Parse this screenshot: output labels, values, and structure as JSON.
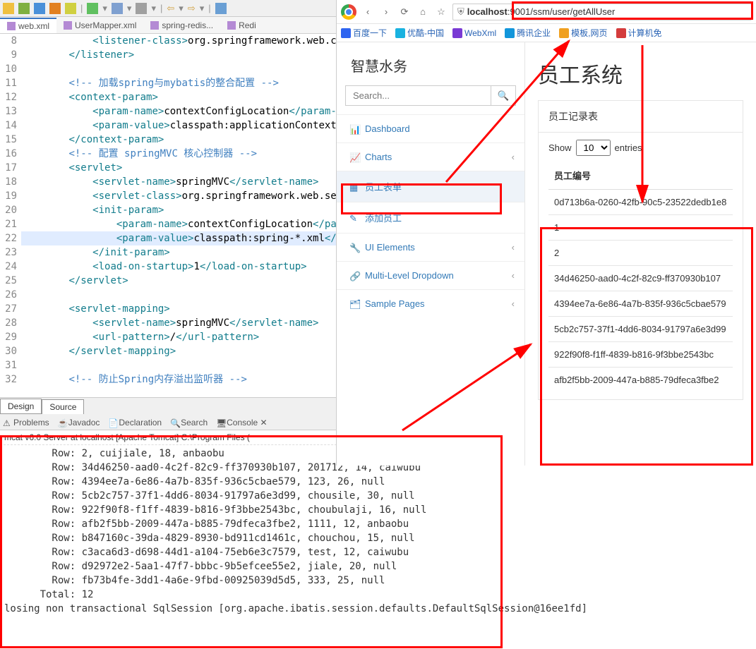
{
  "ide": {
    "tabs": [
      {
        "label": "web.xml",
        "active": true
      },
      {
        "label": "UserMapper.xml",
        "active": false
      },
      {
        "label": "spring-redis...",
        "active": false
      },
      {
        "label": "Redi",
        "active": false
      }
    ],
    "gutter_start": 8,
    "code_lines": [
      {
        "indent": 3,
        "parts": [
          {
            "cls": "c-tag",
            "t": "<listener-class>"
          },
          {
            "cls": "c-txt",
            "t": "org.springframework.web.c"
          }
        ]
      },
      {
        "indent": 2,
        "parts": [
          {
            "cls": "c-tag",
            "t": "</listener>"
          }
        ]
      },
      {
        "indent": 0,
        "parts": [
          {
            "t": ""
          }
        ]
      },
      {
        "indent": 2,
        "parts": [
          {
            "cls": "c-cmt",
            "t": "<!-- 加载spring与mybatis的整合配置 -->"
          }
        ]
      },
      {
        "indent": 2,
        "parts": [
          {
            "cls": "c-tag",
            "t": "<context-param>"
          }
        ]
      },
      {
        "indent": 3,
        "parts": [
          {
            "cls": "c-tag",
            "t": "<param-name>"
          },
          {
            "cls": "c-txt",
            "t": "contextConfigLocation"
          },
          {
            "cls": "c-tag",
            "t": "</param-n"
          }
        ]
      },
      {
        "indent": 3,
        "parts": [
          {
            "cls": "c-tag",
            "t": "<param-value>"
          },
          {
            "cls": "c-txt",
            "t": "classpath:applicationContext"
          }
        ]
      },
      {
        "indent": 2,
        "parts": [
          {
            "cls": "c-tag",
            "t": "</context-param>"
          }
        ]
      },
      {
        "indent": 2,
        "parts": [
          {
            "cls": "c-cmt",
            "t": "<!-- 配置 springMVC 核心控制器 -->"
          }
        ]
      },
      {
        "indent": 2,
        "parts": [
          {
            "cls": "c-tag",
            "t": "<servlet>"
          }
        ]
      },
      {
        "indent": 3,
        "parts": [
          {
            "cls": "c-tag",
            "t": "<servlet-name>"
          },
          {
            "cls": "c-txt",
            "t": "springMVC"
          },
          {
            "cls": "c-tag",
            "t": "</servlet-name>"
          }
        ]
      },
      {
        "indent": 3,
        "parts": [
          {
            "cls": "c-tag",
            "t": "<servlet-class>"
          },
          {
            "cls": "c-txt",
            "t": "org.springframework.web.se"
          }
        ]
      },
      {
        "indent": 3,
        "parts": [
          {
            "cls": "c-tag",
            "t": "<init-param>"
          }
        ]
      },
      {
        "indent": 4,
        "parts": [
          {
            "cls": "c-tag",
            "t": "<param-name>"
          },
          {
            "cls": "c-txt",
            "t": "contextConfigLocation"
          },
          {
            "cls": "c-tag",
            "t": "</pa"
          }
        ]
      },
      {
        "hl": true,
        "indent": 4,
        "parts": [
          {
            "cls": "c-tag",
            "t": "<param-value>"
          },
          {
            "cls": "c-txt",
            "t": "classpath:spring-*.xml"
          },
          {
            "cls": "c-tag",
            "t": "</p"
          }
        ]
      },
      {
        "indent": 3,
        "parts": [
          {
            "cls": "c-tag",
            "t": "</init-param>"
          }
        ]
      },
      {
        "indent": 3,
        "parts": [
          {
            "cls": "c-tag",
            "t": "<load-on-startup>"
          },
          {
            "cls": "c-txt",
            "t": "1"
          },
          {
            "cls": "c-tag",
            "t": "</load-on-startup>"
          }
        ]
      },
      {
        "indent": 2,
        "parts": [
          {
            "cls": "c-tag",
            "t": "</servlet>"
          }
        ]
      },
      {
        "indent": 0,
        "parts": [
          {
            "t": ""
          }
        ]
      },
      {
        "indent": 2,
        "parts": [
          {
            "cls": "c-tag",
            "t": "<servlet-mapping>"
          }
        ]
      },
      {
        "indent": 3,
        "parts": [
          {
            "cls": "c-tag",
            "t": "<servlet-name>"
          },
          {
            "cls": "c-txt",
            "t": "springMVC"
          },
          {
            "cls": "c-tag",
            "t": "</servlet-name>"
          }
        ]
      },
      {
        "indent": 3,
        "parts": [
          {
            "cls": "c-tag",
            "t": "<url-pattern>"
          },
          {
            "cls": "c-txt",
            "t": "/"
          },
          {
            "cls": "c-tag",
            "t": "</url-pattern>"
          }
        ]
      },
      {
        "indent": 2,
        "parts": [
          {
            "cls": "c-tag",
            "t": "</servlet-mapping>"
          }
        ]
      },
      {
        "indent": 0,
        "parts": [
          {
            "t": ""
          }
        ]
      },
      {
        "indent": 2,
        "parts": [
          {
            "cls": "c-cmt",
            "t": "<!-- 防止Spring内存溢出监听器 -->"
          }
        ]
      }
    ],
    "toggle": {
      "design": "Design",
      "source": "Source"
    },
    "console_tabs": [
      "Problems",
      "Javadoc",
      "Declaration",
      "Search",
      "Console"
    ],
    "console_header": "mcat v6.0 Server at localhost [Apache Tomcat] C:\\Program Files (",
    "console_lines": [
      "        Row: 2, cuijiale, 18, anbaobu",
      "        Row: 34d46250-aad0-4c2f-82c9-ff370930b107, 201712, 14, caiwubu",
      "        Row: 4394ee7a-6e86-4a7b-835f-936c5cbae579, 123, 26, null",
      "        Row: 5cb2c757-37f1-4dd6-8034-91797a6e3d99, chousile, 30, null",
      "        Row: 922f90f8-f1ff-4839-b816-9f3bbe2543bc, choubulaji, 16, null",
      "        Row: afb2f5bb-2009-447a-b885-79dfeca3fbe2, 1111, 12, anbaobu",
      "        Row: b847160c-39da-4829-8930-bd911cd1461c, chouchou, 15, null",
      "        Row: c3aca6d3-d698-44d1-a104-75eb6e3c7579, test, 12, caiwubu",
      "        Row: d92972e2-5aa1-47f7-bbbc-9b5efcee55e2, jiale, 20, null",
      "        Row: fb73b4fe-3dd1-4a6e-9fbd-00925039d5d5, 333, 25, null",
      "      Total: 12",
      "losing non transactional SqlSession [org.apache.ibatis.session.defaults.DefaultSqlSession@16ee1fd]"
    ]
  },
  "browser": {
    "url_host": "localhost",
    "url_rest": ":9001/ssm/user/getAllUser",
    "bookmarks": [
      {
        "label": "百度一下",
        "color": "#2e64f0"
      },
      {
        "label": "优酷-中国",
        "color": "#19b2e0"
      },
      {
        "label": "WebXml",
        "color": "#7a3ad4"
      },
      {
        "label": "腾讯企业",
        "color": "#1296db"
      },
      {
        "label": "模板,网页",
        "color": "#f0a020"
      },
      {
        "label": "计算机免",
        "color": "#d43c3c"
      }
    ]
  },
  "admin": {
    "brand": "智慧水务",
    "search_placeholder": "Search...",
    "nav": [
      {
        "label": "Dashboard",
        "icon": "dashboard"
      },
      {
        "label": "Charts",
        "icon": "chart",
        "expandable": true
      },
      {
        "label": "员工表单",
        "icon": "table",
        "selected": true
      },
      {
        "label": "添加员工",
        "icon": "edit"
      },
      {
        "label": "UI Elements",
        "icon": "wrench",
        "expandable": true
      },
      {
        "label": "Multi-Level Dropdown",
        "icon": "tree",
        "expandable": true
      },
      {
        "label": "Sample Pages",
        "icon": "files",
        "expandable": true
      }
    ],
    "page_title": "员工系统",
    "card_title": "员工记录表",
    "show_label": "Show",
    "entries_label": "entries",
    "page_size": "10",
    "table_header": "员工编号",
    "rows": [
      "0d713b6a-0260-42fb-90c5-23522dedb1e8",
      "1",
      "2",
      "34d46250-aad0-4c2f-82c9-ff370930b107",
      "4394ee7a-6e86-4a7b-835f-936c5cbae579",
      "5cb2c757-37f1-4dd6-8034-91797a6e3d99",
      "922f90f8-f1ff-4839-b816-9f3bbe2543bc",
      "afb2f5bb-2009-447a-b885-79dfeca3fbe2"
    ]
  }
}
